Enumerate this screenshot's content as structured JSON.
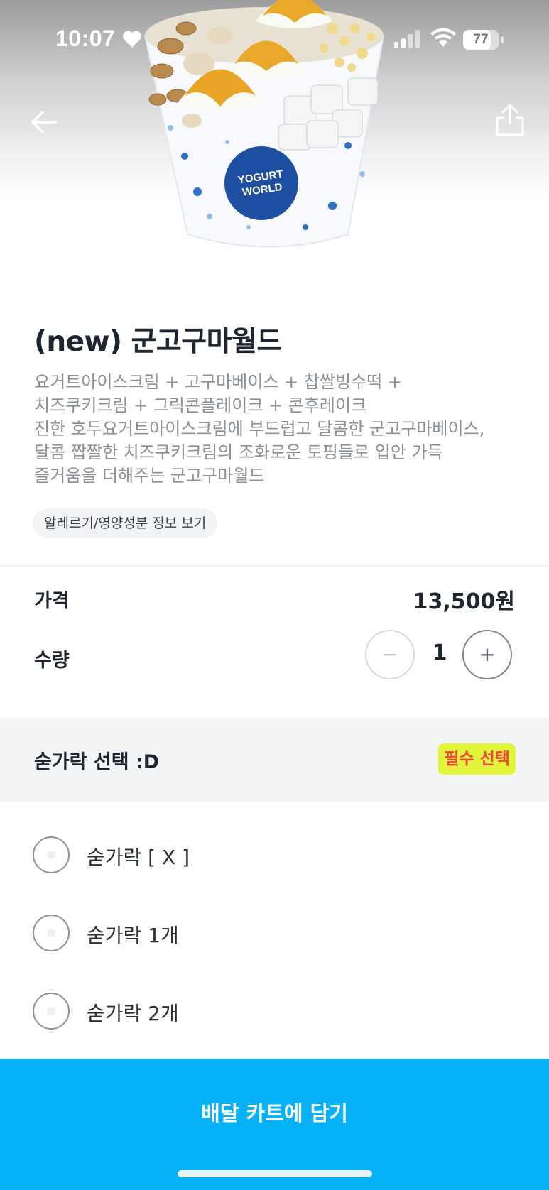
{
  "status_bar": {
    "time": "10:07",
    "battery": "77",
    "battery_level": 0.77
  },
  "header": {
    "back_icon": "arrow-left-icon",
    "share_icon": "share-icon"
  },
  "product": {
    "image": {
      "brand_text_1": "YOGURT",
      "brand_text_2": "WORLD"
    },
    "title": "(new) 군고구마월드",
    "description_lines": [
      "요거트아이스크림 + 고구마베이스 + 찹쌀빙수떡 +",
      "치즈쿠키크림 + 그릭콘플레이크 + 콘후레이크",
      "진한 호두요거트아이스크림에 부드럽고 달콤한 군고구마베이스,",
      "달콤 짭짤한 치즈쿠키크림의 조화로운 토핑들로 입안 가득",
      "즐거움을 더해주는 군고구마월드"
    ],
    "allergy_button": "알레르기/영양성분 정보 보기"
  },
  "price": {
    "label": "가격",
    "value": "13,500원"
  },
  "quantity": {
    "label": "수량",
    "minus": "−",
    "plus": "+",
    "value": "1"
  },
  "option_group": {
    "title": "숟가락 선택 :D",
    "required_badge": "필수 선택",
    "options": [
      {
        "label": "숟가락 [ X ]"
      },
      {
        "label": "숟가락 1개"
      },
      {
        "label": "숟가락 2개"
      }
    ]
  },
  "cta": {
    "label": "배달 카트에 담기"
  },
  "colors": {
    "accent": "#05b2f7",
    "badge_bg": "#e3f53a",
    "badge_text": "#f2453c",
    "section_bg": "#f3f4f6"
  }
}
